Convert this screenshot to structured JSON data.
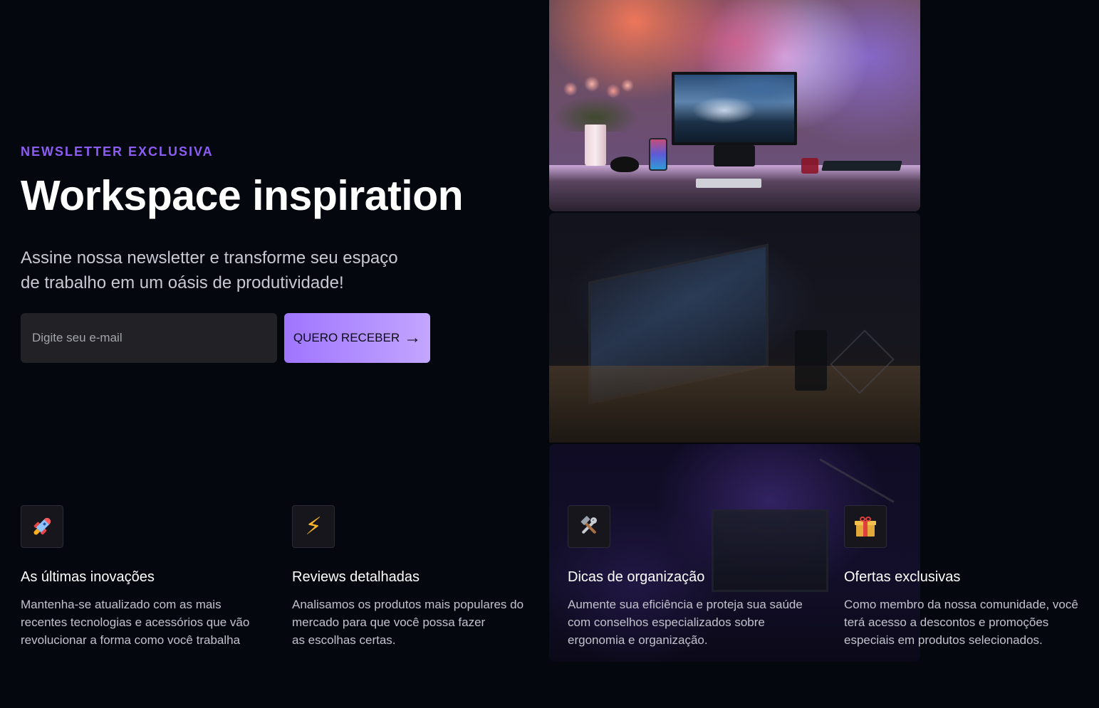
{
  "hero": {
    "eyebrow": "NEWSLETTER EXCLUSIVA",
    "title": "Workspace inspiration",
    "subtitle_line1": "Assine nossa newsletter e transforme seu espaço",
    "subtitle_line2": "de trabalho em um oásis de produtividade!",
    "email_placeholder": "Digite seu e-mail",
    "email_value": "",
    "cta_label": "QUERO RECEBER",
    "cta_icon": "arrow-right-icon"
  },
  "colors": {
    "background": "#05070f",
    "accent": "#8d5cf6",
    "button_gradient_start": "#9f75ff",
    "button_gradient_end": "#c3a6ff",
    "input_background": "#222226"
  },
  "gallery": {
    "images": [
      {
        "subject": "desk-monitor-tulips-neon-light"
      },
      {
        "subject": "dark-desk-monitor-speaker-lamp"
      },
      {
        "subject": "purple-lit-desk-setup"
      }
    ]
  },
  "features": [
    {
      "icon": "rocket-icon",
      "title": "As últimas inovações",
      "desc_line1": "Mantenha-se atualizado com as mais",
      "desc_line2": "recentes tecnologias e acessórios que vão",
      "desc_line3": "revolucionar a forma como você trabalha"
    },
    {
      "icon": "lightning-icon",
      "title": "Reviews detalhadas",
      "desc_line1": "Analisamos os produtos mais populares do",
      "desc_line2": "mercado para que você possa fazer",
      "desc_line3": "as escolhas certas."
    },
    {
      "icon": "tools-icon",
      "title": "Dicas de organização",
      "desc_line1": "Aumente sua eficiência e proteja sua saúde",
      "desc_line2": "com conselhos especializados sobre",
      "desc_line3": "ergonomia e organização."
    },
    {
      "icon": "gift-icon",
      "title": "Ofertas exclusivas",
      "desc_line1": "Como membro da nossa comunidade, você",
      "desc_line2": "terá acesso a descontos e promoções",
      "desc_line3": "especiais em produtos selecionados."
    }
  ]
}
